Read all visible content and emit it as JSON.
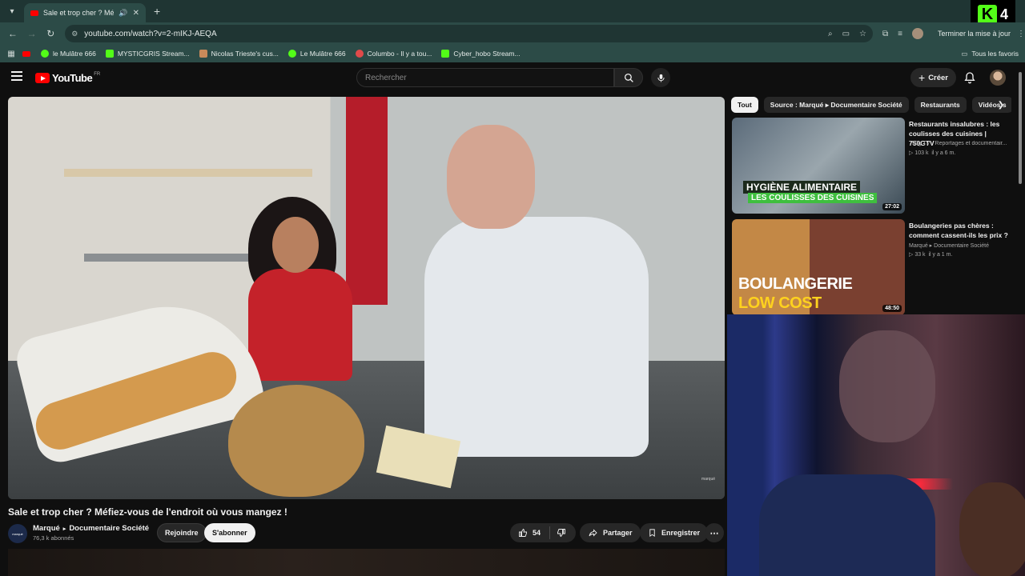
{
  "browser": {
    "tab_title": "Sale et trop cher ? Méfiez-v",
    "url": "youtube.com/watch?v=2-mIKJ-AEQA",
    "update_label": "Terminer la mise à jour",
    "kick_badge": "4",
    "bookmarks": [
      {
        "label": "le Mulâtre 666",
        "color": "#53fc18"
      },
      {
        "label": "MYSTICGRIS Stream...",
        "color": "#53fc18"
      },
      {
        "label": "Nicolas Trieste's cus...",
        "color": "#c98a5a"
      },
      {
        "label": "Le Mulâtre 666",
        "color": "#53fc18"
      },
      {
        "label": "Columbo - Il y a tou...",
        "color": "#e04a4a"
      },
      {
        "label": "Cyber_hobo Stream...",
        "color": "#53fc18"
      }
    ],
    "bookmarks_all": "Tous les favoris"
  },
  "youtube": {
    "logo_text": "YouTube",
    "logo_region": "FR",
    "search_placeholder": "Rechercher",
    "create_label": "Créer"
  },
  "video": {
    "title": "Sale et trop cher ? Méfiez-vous de l'endroit où vous mangez !",
    "watermark": "marqué",
    "channel_name": "Marqué",
    "channel_sub": "Documentaire Société",
    "channel_avatar_text": "marqué",
    "subscribers": "76,3 k abonnés",
    "join_label": "Rejoindre",
    "subscribe_label": "S'abonner",
    "likes": "54",
    "share_label": "Partager",
    "save_label": "Enregistrer"
  },
  "sidebar": {
    "chips": [
      {
        "label": "Tout",
        "active": true
      },
      {
        "label": "Source : Marqué ▸ Documentaire Société",
        "active": false
      },
      {
        "label": "Restaurants",
        "active": false
      },
      {
        "label": "Vidéos s",
        "active": false
      }
    ],
    "recommendations": [
      {
        "title": "Restaurants insalubres : les coulisses des cuisines | 750GTV",
        "channel": "750g TV - Reportages et documentair...",
        "views": "103 k",
        "age": "il y a 6 m.",
        "duration": "27:02",
        "caption1": "HYGIÈNE ALIMENTAIRE",
        "caption2": "LES COULISSES DES CUISINES"
      },
      {
        "title": "Boulangeries pas chères : comment cassent-ils les prix ?",
        "channel": "Marqué ▸ Documentaire Société",
        "views": "33 k",
        "age": "il y a 1 m.",
        "duration": "48:50",
        "caption1": "BOULANGERIE",
        "caption2": "LOW COST"
      }
    ]
  }
}
